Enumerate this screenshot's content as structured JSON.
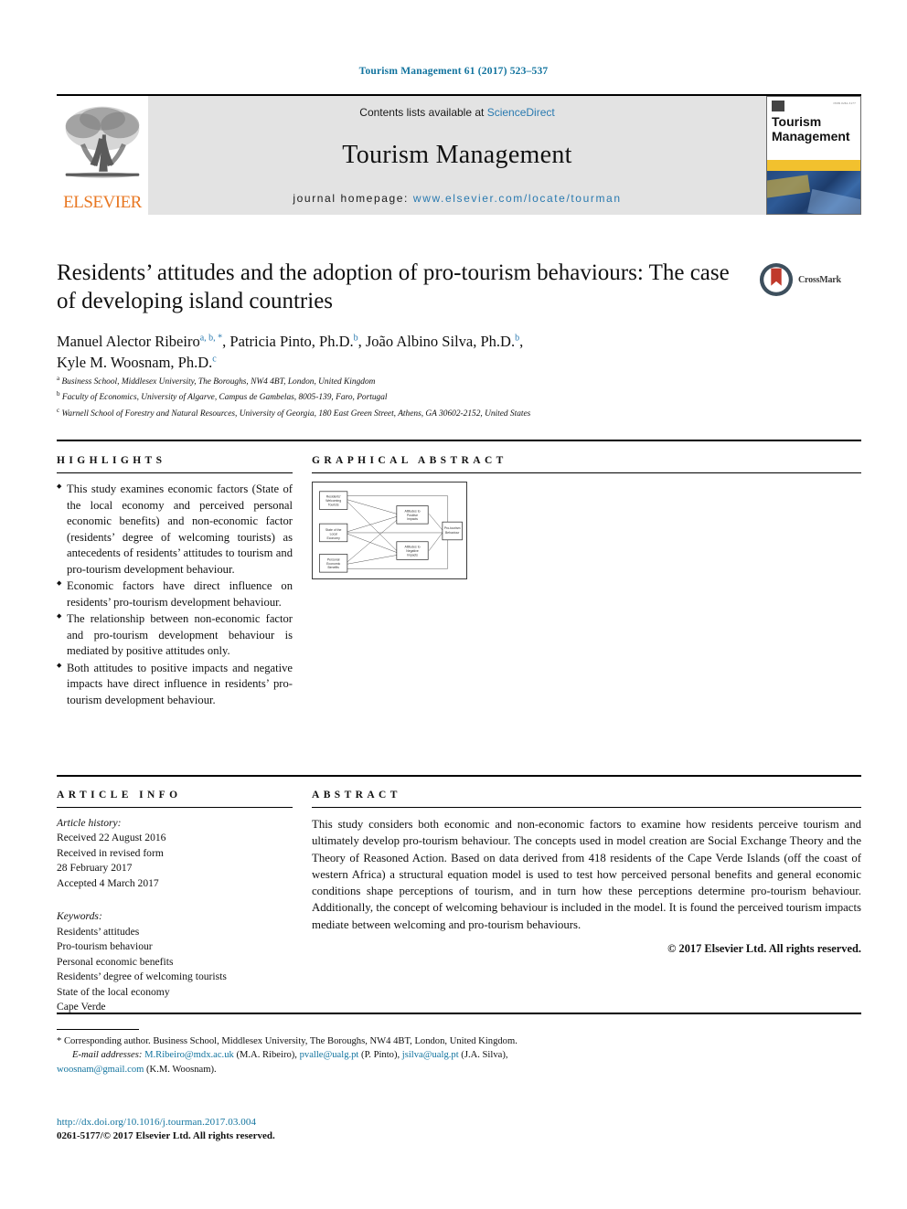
{
  "running_head": "Tourism Management 61 (2017) 523–537",
  "masthead": {
    "publisher_wordmark": "ELSEVIER",
    "contents_prefix": "Contents lists available at ",
    "contents_link": "ScienceDirect",
    "journal_title": "Tourism Management",
    "homepage_prefix": "journal homepage: ",
    "homepage_link": "www.elsevier.com/locate/tourman",
    "cover": {
      "title_line1": "Tourism",
      "title_line2": "Management",
      "issn_caption": "ISSN 0261-5177"
    }
  },
  "article": {
    "title": "Residents’ attitudes and the adoption of pro-tourism behaviours: The case of developing island countries",
    "authors": [
      {
        "name": "Manuel Alector Ribeiro",
        "marks": "a, b, *"
      },
      {
        "name": "Patricia Pinto, Ph.D.",
        "marks": "b"
      },
      {
        "name": "João Albino Silva, Ph.D.",
        "marks": "b"
      },
      {
        "name": "Kyle M. Woosnam, Ph.D.",
        "marks": "c"
      }
    ],
    "affiliations": [
      {
        "mark": "a",
        "text": "Business School, Middlesex University, The Boroughs, NW4 4BT, London, United Kingdom"
      },
      {
        "mark": "b",
        "text": "Faculty of Economics, University of Algarve, Campus de Gambelas, 8005-139, Faro, Portugal"
      },
      {
        "mark": "c",
        "text": "Warnell School of Forestry and Natural Resources, University of Georgia, 180 East Green Street, Athens, GA 30602-2152, United States"
      }
    ],
    "crossmark_label": "CrossMark"
  },
  "highlights": {
    "heading": "HIGHLIGHTS",
    "items": [
      "This study examines economic factors (State of the local economy and perceived personal economic benefits) and non-economic factor (residents’ degree of welcoming tourists) as antecedents of residents’ attitudes to tourism and pro-tourism development behaviour.",
      "Economic factors have direct influence on residents’ pro-tourism development behaviour.",
      "The relationship between non-economic factor and pro-tourism development behaviour is mediated by positive attitudes only.",
      "Both attitudes to positive impacts and negative impacts have direct influence in residents’ pro-tourism development behaviour."
    ]
  },
  "graphical_abstract": {
    "heading": "GRAPHICAL ABSTRACT",
    "nodes": [
      {
        "id": "welcoming",
        "label": "Residents' Welcoming Tourists"
      },
      {
        "id": "economy",
        "label": "State of the Local Economy"
      },
      {
        "id": "benefits",
        "label": "Personal Economic Benefits"
      },
      {
        "id": "pos",
        "label": "Attitudes to Positive Impacts"
      },
      {
        "id": "neg",
        "label": "Attitudes to Negative Impacts"
      },
      {
        "id": "behaviour",
        "label": "Pro-tourism Behaviour"
      }
    ]
  },
  "article_info": {
    "heading": "ARTICLE INFO",
    "history_label": "Article history:",
    "history": [
      "Received 22 August 2016",
      "Received in revised form",
      "28 February 2017",
      "Accepted 4 March 2017"
    ],
    "keywords_label": "Keywords:",
    "keywords": [
      "Residents’ attitudes",
      "Pro-tourism behaviour",
      "Personal economic benefits",
      "Residents’ degree of welcoming tourists",
      "State of the local economy",
      "Cape Verde"
    ]
  },
  "abstract": {
    "heading": "ABSTRACT",
    "body": "This study considers both economic and non-economic factors to examine how residents perceive tourism and ultimately develop pro-tourism behaviour. The concepts used in model creation are Social Exchange Theory and the Theory of Reasoned Action. Based on data derived from 418 residents of the Cape Verde Islands (off the coast of western Africa) a structural equation model is used to test how perceived personal benefits and general economic conditions shape perceptions of tourism, and in turn how these perceptions determine pro-tourism behaviour. Additionally, the concept of welcoming behaviour is included in the model. It is found the perceived tourism impacts mediate between welcoming and pro-tourism behaviours.",
    "copyright": "© 2017 Elsevier Ltd. All rights reserved."
  },
  "footnotes": {
    "corresponding": "* Corresponding author. Business School, Middlesex University, The Boroughs, NW4 4BT, London, United Kingdom.",
    "email_label": "E-mail addresses:",
    "emails": [
      {
        "address": "M.Ribeiro@mdx.ac.uk",
        "owner": "(M.A. Ribeiro),"
      },
      {
        "address": "pvalle@ualg.pt",
        "owner": "(P. Pinto),"
      },
      {
        "address": "jsilva@ualg.pt",
        "owner": "(J.A. Silva),"
      },
      {
        "address": "woosnam@gmail.com",
        "owner": "(K.M. Woosnam)."
      }
    ],
    "doi": "http://dx.doi.org/10.1016/j.tourman.2017.03.004",
    "issn": "0261-5177/© 2017 Elsevier Ltd. All rights reserved."
  },
  "colors": {
    "link": "#11739e",
    "sciencedirect": "#2a7ab0",
    "elsevier_orange": "#e87722",
    "masthead_bg": "#e3e3e3",
    "cover_band": "#f2c12e",
    "crossmark_red": "#c0392b"
  }
}
